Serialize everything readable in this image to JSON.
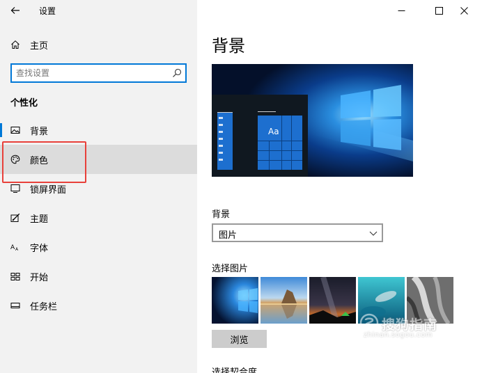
{
  "window": {
    "title": "设置",
    "controls": [
      "minimize",
      "maximize",
      "close"
    ]
  },
  "sidebar": {
    "home_label": "主页",
    "search_placeholder": "查找设置",
    "section_title": "个性化",
    "items": [
      {
        "label": "背景",
        "icon": "image-icon",
        "active": true
      },
      {
        "label": "颜色",
        "icon": "palette-icon",
        "selected": true
      },
      {
        "label": "锁屏界面",
        "icon": "lock-screen-icon"
      },
      {
        "label": "主题",
        "icon": "theme-icon"
      },
      {
        "label": "字体",
        "icon": "font-icon"
      },
      {
        "label": "开始",
        "icon": "start-icon"
      },
      {
        "label": "任务栏",
        "icon": "taskbar-icon"
      }
    ]
  },
  "main": {
    "title": "背景",
    "preview_tile_text": "Aa",
    "background_label": "背景",
    "background_value": "图片",
    "choose_picture_label": "选择图片",
    "browse_label": "浏览",
    "fit_label": "选择契合度"
  },
  "watermark": {
    "brand": "搜狗指南",
    "url": "zhinan.sogou.com"
  },
  "colors": {
    "accent": "#0078d7",
    "sidebar_bg": "#f2f2f2",
    "selected_bg": "#dcdcdc",
    "highlight_border": "#e8403a"
  }
}
